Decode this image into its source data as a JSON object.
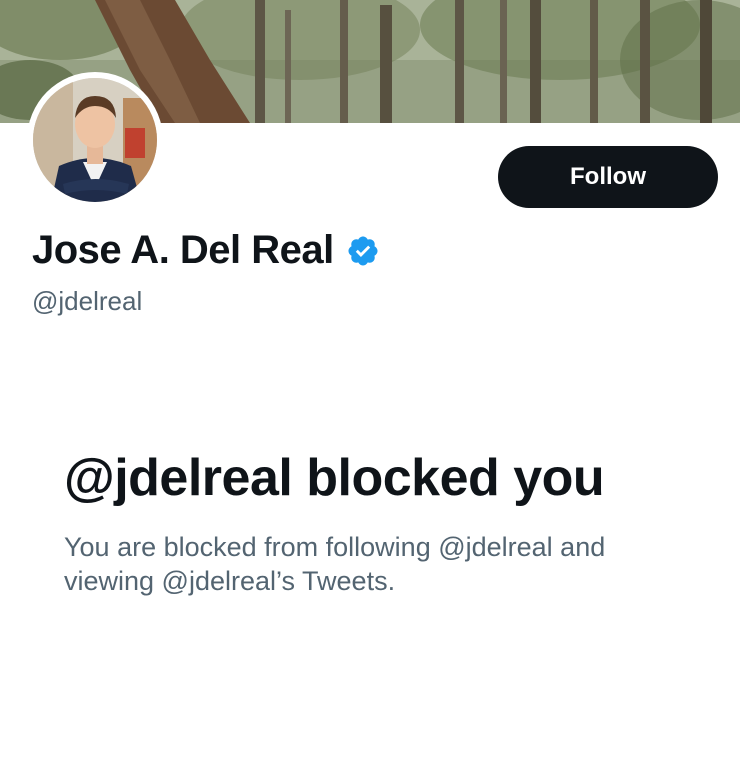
{
  "profile": {
    "display_name": "Jose A. Del Real",
    "handle": "@jdelreal",
    "verified": true,
    "follow_label": "Follow"
  },
  "blocked": {
    "title": "@jdelreal blocked you",
    "description": "You are blocked from following @jdelreal and viewing @jdelreal’s Tweets."
  },
  "icons": {
    "verified": "verified-badge-icon"
  },
  "colors": {
    "button_bg": "#0f1419",
    "text_primary": "#0f1419",
    "text_secondary": "#536471",
    "verified_blue": "#1d9bf0"
  }
}
